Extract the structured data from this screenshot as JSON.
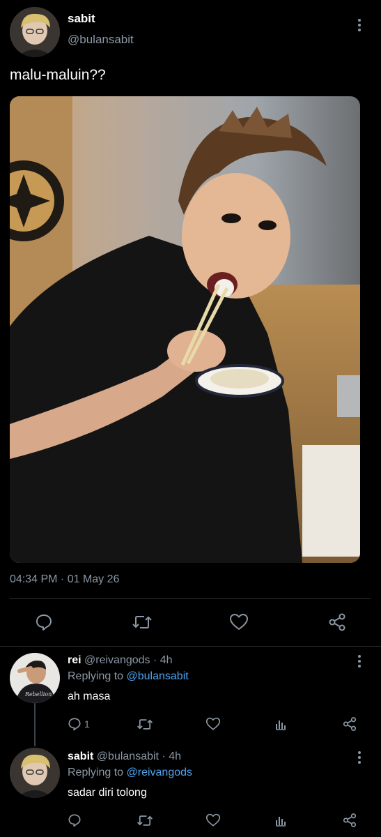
{
  "tweet": {
    "display_name": "sabit",
    "handle": "@bulansabit",
    "text": "malu-maluin??",
    "timestamp": "04:34 PM · 01 May 26",
    "more_icon": "more-vertical-icon"
  },
  "main_actions": [
    {
      "icon": "reply-icon"
    },
    {
      "icon": "retweet-icon"
    },
    {
      "icon": "like-icon"
    },
    {
      "icon": "share-icon"
    }
  ],
  "replies": [
    {
      "display_name": "rei",
      "handle": "@reivangods",
      "dot": "·",
      "time": "4h",
      "replying_label": "Replying to",
      "replying_to": "@bulansabit",
      "text": "ah masa",
      "reply_count": "1"
    },
    {
      "display_name": "sabit",
      "handle": "@bulansabit",
      "dot": "·",
      "time": "4h",
      "replying_label": "Replying to",
      "replying_to": "@reivangods",
      "text": "sadar diri tolong",
      "reply_count": ""
    }
  ],
  "colors": {
    "background": "#000000",
    "text": "#e7e9ea",
    "muted": "#8b98a5",
    "link": "#4ea3ee",
    "divider": "#2f3336"
  }
}
